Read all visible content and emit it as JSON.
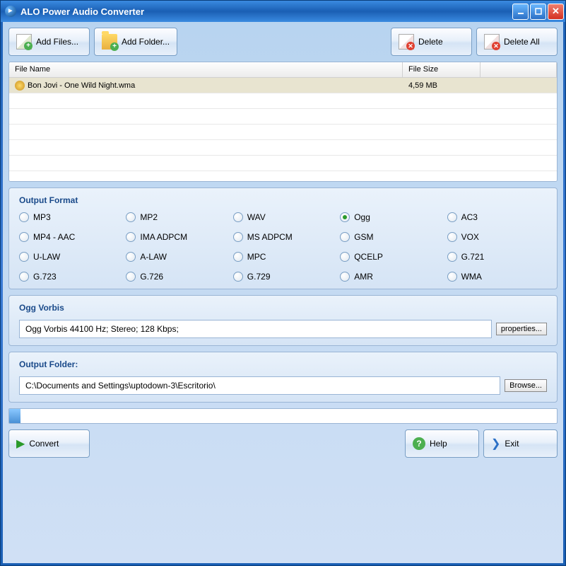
{
  "window": {
    "title": "ALO Power Audio Converter"
  },
  "toolbar": {
    "add_files": "Add Files...",
    "add_folder": "Add Folder...",
    "delete": "Delete",
    "delete_all": "Delete All"
  },
  "table": {
    "col_name": "File Name",
    "col_size": "File Size",
    "rows": [
      {
        "name": "Bon Jovi - One Wild Night.wma",
        "size": "4,59 MB"
      }
    ]
  },
  "output_format": {
    "title": "Output Format",
    "selected": "Ogg",
    "options": [
      "MP3",
      "MP2",
      "WAV",
      "Ogg",
      "AC3",
      "MP4 - AAC",
      "IMA ADPCM",
      "MS ADPCM",
      "GSM",
      "VOX",
      "U-LAW",
      "A-LAW",
      "MPC",
      "QCELP",
      "G.721",
      "G.723",
      "G.726",
      "G.729",
      "AMR",
      "WMA"
    ]
  },
  "codec": {
    "title": "Ogg Vorbis",
    "settings": "Ogg Vorbis 44100 Hz; Stereo; 128 Kbps;",
    "properties_btn": "properties..."
  },
  "output_folder": {
    "title": "Output Folder:",
    "path": "C:\\Documents and Settings\\uptodown-3\\Escritorio\\",
    "browse_btn": "Browse..."
  },
  "progress": {
    "percent": 2
  },
  "bottom": {
    "convert": "Convert",
    "help": "Help",
    "exit": "Exit"
  }
}
